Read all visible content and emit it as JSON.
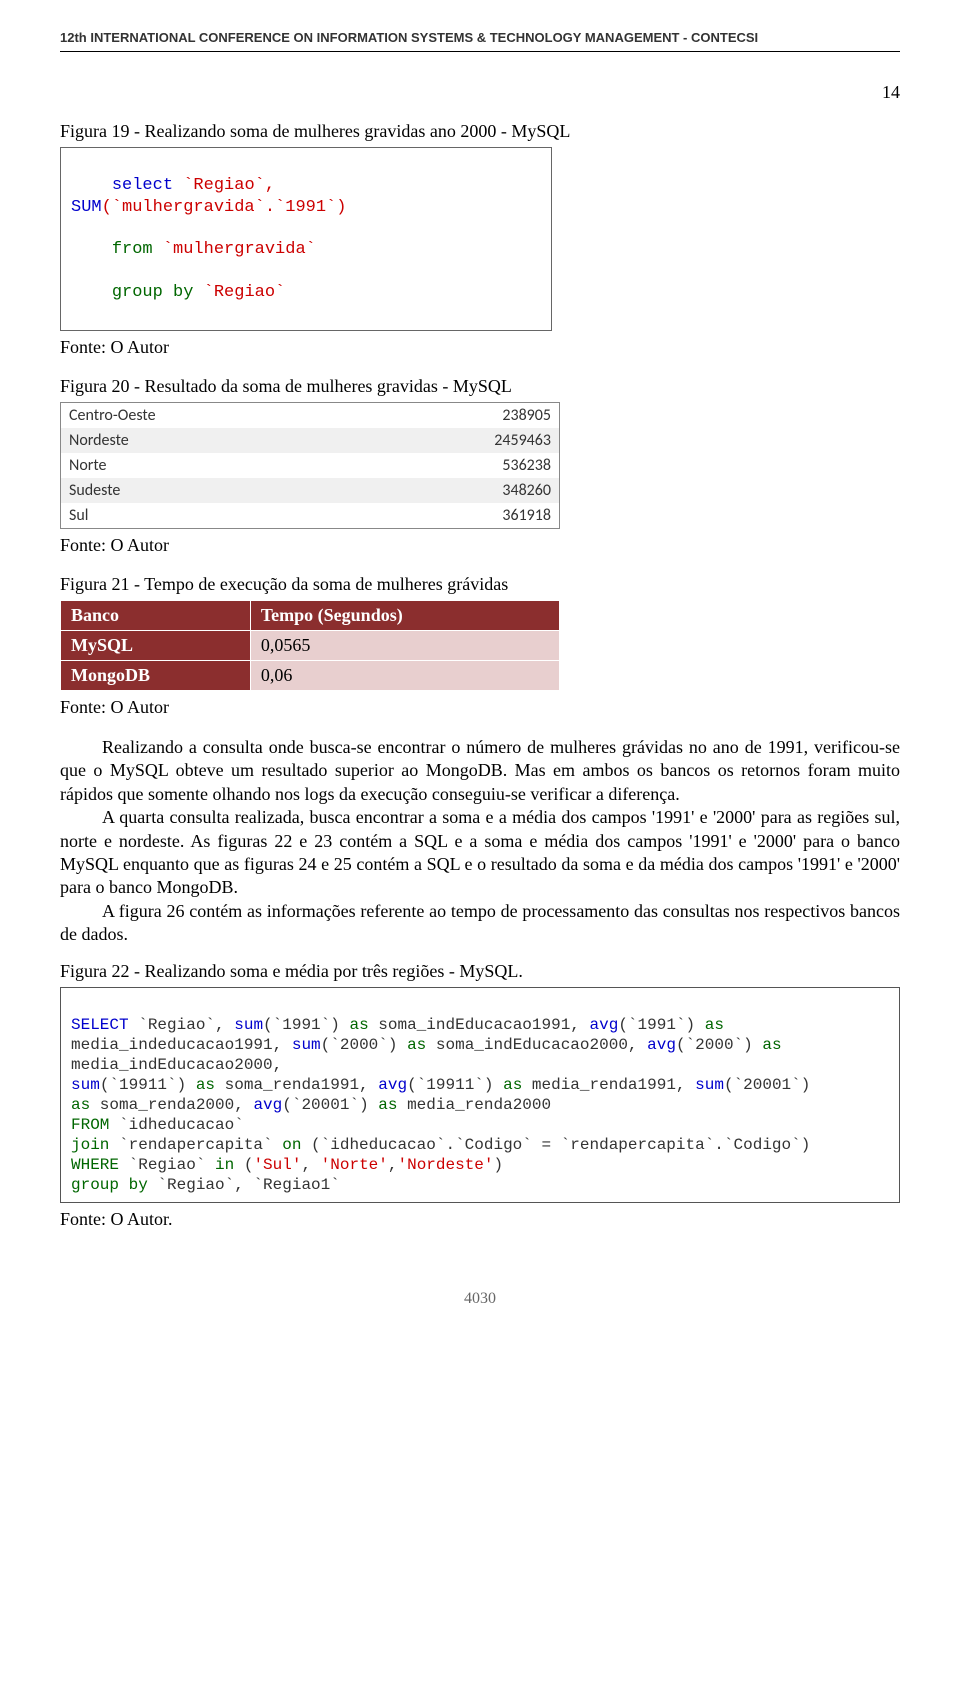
{
  "header": "12th INTERNATIONAL CONFERENCE ON INFORMATION SYSTEMS & TECHNOLOGY MANAGEMENT - CONTECSI",
  "page_number_top": "14",
  "captions": {
    "fig19": "Figura 19 - Realizando soma de mulheres gravidas ano 2000 - MySQL",
    "fig20": "Figura 20 - Resultado da soma de mulheres gravidas - MySQL",
    "fig21": "Figura 21 - Tempo de execução da soma de mulheres grávidas",
    "fig22": "Figura 22 - Realizando soma e média por três regiões - MySQL."
  },
  "source": "Fonte: O Autor",
  "source_dot": "Fonte: O Autor.",
  "sql1": {
    "line1": {
      "pre": "select",
      "mid1": " `Regiao`, ",
      "fn": "SUM",
      "mid2": "(`mulhergravida`.`1991`)"
    },
    "line2": {
      "from": "from",
      "tbl": " `mulhergravida`"
    },
    "line3": {
      "gb": "group by",
      "fld": " `Regiao`"
    }
  },
  "result_rows": [
    {
      "region": "Centro-Oeste",
      "value": "238905"
    },
    {
      "region": "Nordeste",
      "value": "2459463"
    },
    {
      "region": "Norte",
      "value": "536238"
    },
    {
      "region": "Sudeste",
      "value": "348260"
    },
    {
      "region": "Sul",
      "value": "361918"
    }
  ],
  "time_table": {
    "header_banco": "Banco",
    "header_tempo": "Tempo (Segundos)",
    "rows": [
      {
        "db": "MySQL",
        "val": "0,0565"
      },
      {
        "db": "MongoDB",
        "val": "0,06"
      }
    ]
  },
  "paragraphs": {
    "p1": "Realizando a consulta onde busca-se encontrar o número de mulheres grávidas no ano de 1991, verificou-se que o MySQL obteve um resultado superior ao MongoDB. Mas em ambos os bancos os retornos foram muito rápidos que somente olhando nos logs da execução conseguiu-se verificar a diferença.",
    "p2": "A quarta consulta realizada, busca encontrar a soma e a média dos campos '1991' e '2000' para as regiões sul, norte e nordeste. As figuras 22 e 23 contém a SQL e a soma e média dos campos '1991' e '2000' para o banco MySQL enquanto que as figuras 24 e 25 contém a SQL e o resultado da soma e da média dos campos '1991' e '2000' para o banco MongoDB.",
    "p3": "A figura 26 contém as informações referente ao tempo de processamento das consultas nos respectivos bancos de dados."
  },
  "sql2": {
    "l1": {
      "a": "SELECT",
      "b": " `Regiao`, ",
      "c": "sum",
      "d": "(`1991`) ",
      "e": "as",
      "f": " soma_indEducacao1991, ",
      "g": "avg",
      "h": "(`1991`) ",
      "i": "as"
    },
    "l2": {
      "a": "media_indeducacao1991, ",
      "b": "sum",
      "c": "(`2000`) ",
      "d": "as",
      "e": " soma_indEducacao2000, ",
      "f": "avg",
      "g": "(`2000`) ",
      "h": "as"
    },
    "l3": {
      "a": "media_indEducacao2000,"
    },
    "l4": {
      "a": "sum",
      "b": "(`19911`) ",
      "c": "as",
      "d": " soma_renda1991, ",
      "e": "avg",
      "f": "(`19911`) ",
      "g": "as",
      "h": " media_renda1991, ",
      "i": "sum",
      "j": "(`20001`)"
    },
    "l5": {
      "a": "as",
      "b": " soma_renda2000, ",
      "c": "avg",
      "d": "(`20001`) ",
      "e": "as",
      "f": " media_renda2000"
    },
    "l6": {
      "a": "FROM",
      "b": " `idheducacao`"
    },
    "l7": {
      "a": "join",
      "b": " `rendapercapita` ",
      "c": "on",
      "d": " (`idheducacao`.`Codigo` = `rendapercapita`.`Codigo`)"
    },
    "l8": {
      "a": "WHERE",
      "b": " `Regiao` ",
      "c": "in",
      "d": " (",
      "e": "'Sul'",
      "f": ", ",
      "g": "'Norte'",
      "h": ",",
      "i": "'Nordeste'",
      "j": ")"
    },
    "l9": {
      "a": "group by",
      "b": " `Regiao`, `Regiao1`"
    }
  },
  "footer_page": "4030"
}
